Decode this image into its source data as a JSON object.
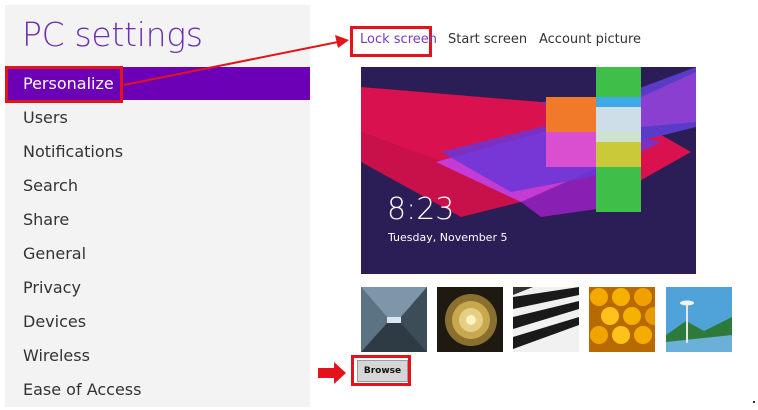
{
  "header": {
    "title": "PC settings"
  },
  "sidebar": {
    "items": [
      {
        "label": "Personalize",
        "selected": true
      },
      {
        "label": "Users"
      },
      {
        "label": "Notifications"
      },
      {
        "label": "Search"
      },
      {
        "label": "Share"
      },
      {
        "label": "General"
      },
      {
        "label": "Privacy"
      },
      {
        "label": "Devices"
      },
      {
        "label": "Wireless"
      },
      {
        "label": "Ease of Access"
      }
    ]
  },
  "tabs": [
    {
      "label": "Lock screen",
      "active": true
    },
    {
      "label": "Start screen"
    },
    {
      "label": "Account picture"
    }
  ],
  "preview": {
    "time": "8:23",
    "date": "Tuesday, November 5"
  },
  "thumbnails": [
    "tunnel",
    "nautilus-shell",
    "piano-keys",
    "honeycomb",
    "space-needle"
  ],
  "browse": {
    "label": "Browse"
  },
  "colors": {
    "accent": "#6b00b7",
    "title": "#6a2fb0",
    "highlight": "#e3131b"
  }
}
